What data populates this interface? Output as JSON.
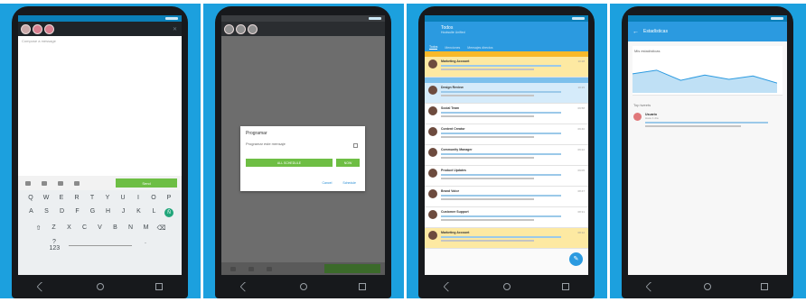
{
  "brand": {
    "panel_bg": "#1ca0de",
    "accent_green": "#6ebe44",
    "accent_blue": "#2b9ae0",
    "highlight_yellow": "#fde9a2"
  },
  "panel1": {
    "compose_placeholder": "Compose a message",
    "send_label": "Send",
    "keyboard": {
      "row1": [
        "Q",
        "W",
        "E",
        "R",
        "T",
        "Y",
        "U",
        "I",
        "O",
        "P"
      ],
      "row2": [
        "A",
        "S",
        "D",
        "F",
        "G",
        "H",
        "J",
        "K",
        "L",
        "Ñ"
      ],
      "row3": [
        "⇧",
        "Z",
        "X",
        "C",
        "V",
        "B",
        "N",
        "M",
        "⌫"
      ],
      "row4_left": "?123",
      "row4_right": "."
    }
  },
  "panel2": {
    "dialog_title": "Programar",
    "dialog_line": "Programar este mensaje",
    "primary_button": "ALL SCHEDULE",
    "secondary_button": "NOW",
    "link_cancel": "Cancel",
    "link_schedule": "Schedule"
  },
  "panel3": {
    "title": "Todos",
    "subtitle": "Hootsuite Unified",
    "tabs": [
      "Todos",
      "Menciones",
      "Mensajes directos"
    ],
    "items": [
      {
        "name": "Marketing Account",
        "time": "10:28",
        "style": "yellow"
      },
      {
        "name": "Design Review",
        "time": "10:15",
        "style": "blue"
      },
      {
        "name": "Social Team",
        "time": "09:58",
        "style": "plain"
      },
      {
        "name": "Content Creator",
        "time": "09:40",
        "style": "plain"
      },
      {
        "name": "Community Manager",
        "time": "09:22",
        "style": "plain"
      },
      {
        "name": "Product Updates",
        "time": "09:05",
        "style": "plain"
      },
      {
        "name": "Brand Voice",
        "time": "08:47",
        "style": "plain"
      },
      {
        "name": "Customer Support",
        "time": "08:31",
        "style": "plain"
      },
      {
        "name": "Marketing Account",
        "time": "08:12",
        "style": "yellow"
      }
    ]
  },
  "panel4": {
    "title": "Estadísticas",
    "card_title": "Mis estadísticas",
    "section_title": "Top tweets",
    "item_name": "Usuario",
    "item_time": "Hace 1 día",
    "chart_data": {
      "type": "area",
      "values": [
        0.62,
        0.74,
        0.41,
        0.58,
        0.44,
        0.55,
        0.32
      ],
      "ylim": [
        0,
        1
      ]
    }
  }
}
